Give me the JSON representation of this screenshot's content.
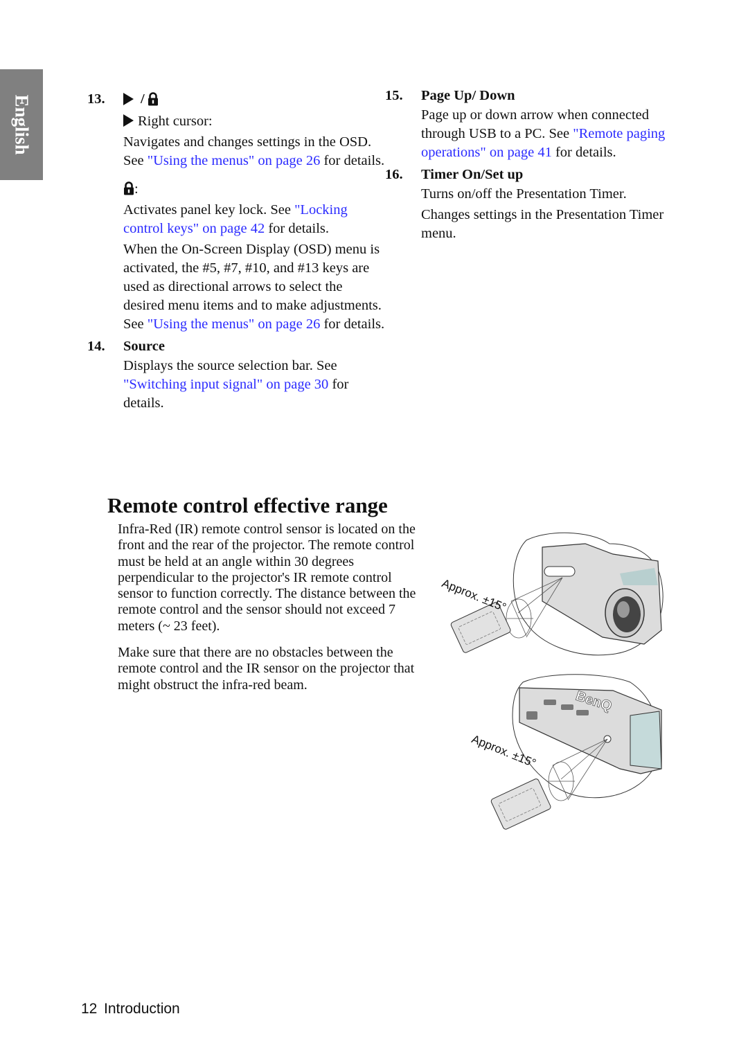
{
  "side_tab": {
    "label": "English",
    "color": "#808080"
  },
  "left_column": {
    "item13": {
      "number": "13.",
      "separator": "/",
      "right_cursor_label": "Right cursor:",
      "right_cursor_text_1": "Navigates and changes settings in the OSD. See ",
      "right_cursor_link": "\"Using the menus\" on page 26",
      "right_cursor_text_2": " for details.",
      "lock_suffix": ":",
      "lock_text_1": "Activates panel key lock. See ",
      "lock_link": "\"Locking control keys\" on page 42",
      "lock_text_2": " for details.",
      "osd_text_1": "When the On-Screen Display (OSD) menu is activated, the #5, #7, #10, and #13 keys are used as directional arrows to select the desired menu items and to make adjustments. See ",
      "osd_link": "\"Using the menus\" on page 26",
      "osd_text_2": " for details."
    },
    "item14": {
      "number": "14.",
      "title": "Source",
      "text_1": "Displays the source selection bar. See ",
      "link": "\"Switching input signal\" on page 30",
      "text_2": " for details."
    }
  },
  "right_column": {
    "item15": {
      "number": "15.",
      "title": "Page Up/ Down",
      "text_1": "Page up or down arrow when connected through USB to a PC. See ",
      "link": "\"Remote paging operations\" on page 41",
      "text_2": " for details."
    },
    "item16": {
      "number": "16.",
      "title": "Timer On/Set up",
      "text_1": "Turns on/off the Presentation Timer.",
      "text_2": "Changes settings in the Presentation Timer menu."
    }
  },
  "section": {
    "title": "Remote control effective range",
    "paragraph_1": "Infra-Red (IR) remote control sensor is located on the front and the rear of the projector. The remote control must be held at an angle within 30 degrees perpendicular to the projector's IR remote control sensor to function correctly. The distance between the remote control and the sensor should not exceed 7 meters (~ 23 feet).",
    "paragraph_2": "Make sure that there are no obstacles between the remote control and the IR sensor on the projector that might obstruct the infra-red beam."
  },
  "figures": {
    "front": {
      "label": "Approx. ±15°"
    },
    "rear": {
      "label": "Approx. ±15°",
      "brand_text": "BenQ"
    }
  },
  "footer": {
    "page_number": "12",
    "chapter": "Introduction"
  },
  "colors": {
    "link": "#2b2bff",
    "text": "#111111"
  }
}
